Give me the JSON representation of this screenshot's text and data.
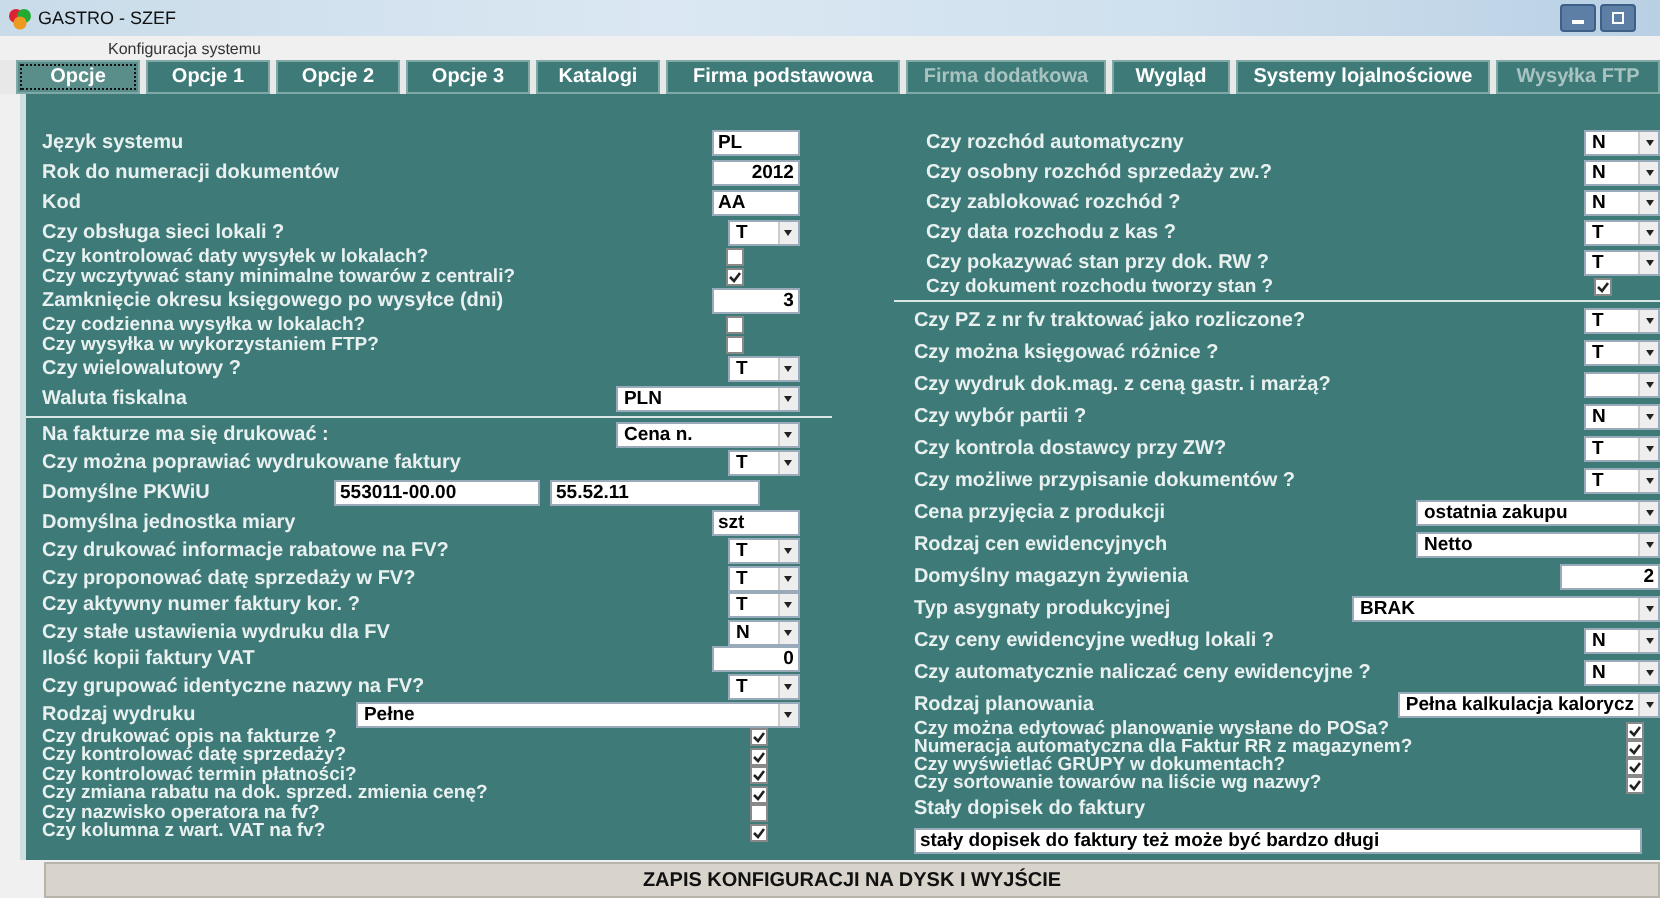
{
  "window": {
    "title": "GASTRO - SZEF",
    "subtitle": "Konfiguracja systemu"
  },
  "tabs": [
    {
      "label": "Opcje",
      "selected": true,
      "disabled": false
    },
    {
      "label": "Opcje 1",
      "selected": false,
      "disabled": false
    },
    {
      "label": "Opcje 2",
      "selected": false,
      "disabled": false
    },
    {
      "label": "Opcje 3",
      "selected": false,
      "disabled": false
    },
    {
      "label": "Katalogi",
      "selected": false,
      "disabled": false
    },
    {
      "label": "Firma podstawowa",
      "selected": false,
      "disabled": false
    },
    {
      "label": "Firma dodatkowa",
      "selected": false,
      "disabled": true
    },
    {
      "label": "Wygląd",
      "selected": false,
      "disabled": false
    },
    {
      "label": "Systemy lojalnościowe",
      "selected": false,
      "disabled": false
    },
    {
      "label": "Wysyłka FTP",
      "selected": false,
      "disabled": true
    }
  ],
  "left_sections": [
    {
      "rows": [
        {
          "kind": "input",
          "label": "Język systemu",
          "value": "PL"
        },
        {
          "kind": "number",
          "label": "Rok do numeracji dokumentów",
          "value": "2012"
        },
        {
          "kind": "input",
          "label": "Kod",
          "value": "AA"
        },
        {
          "kind": "dropdown",
          "label": "Czy obsługa sieci lokali ?",
          "value": "T"
        },
        {
          "kind": "check",
          "label": "Czy kontrolować daty wysyłek w lokalach?",
          "checked": false
        },
        {
          "kind": "check",
          "label": "Czy wczytywać stany minimalne towarów z centrali?",
          "checked": true
        },
        {
          "kind": "number",
          "label": "Zamknięcie okresu księgowego po wysyłce (dni)",
          "value": "3"
        },
        {
          "kind": "check",
          "label": "Czy codzienna wysyłka w lokalach?",
          "checked": false
        },
        {
          "kind": "check",
          "label": "Czy wysyłka w wykorzystaniem FTP?",
          "checked": false
        },
        {
          "kind": "dropdown",
          "label": "Czy wielowalutowy ?",
          "value": "T"
        },
        {
          "kind": "combo",
          "label": "Waluta fiskalna",
          "value": "PLN"
        }
      ]
    },
    {
      "rows": [
        {
          "kind": "combo",
          "label": "Na fakturze ma się drukować :",
          "value": "Cena n."
        },
        {
          "kind": "dropdown",
          "label": "Czy można poprawiać wydrukowane faktury",
          "value": "T"
        },
        {
          "kind": "pair",
          "label": "Domyślne PKWiU",
          "values": [
            "553011-00.00",
            "55.52.11"
          ]
        },
        {
          "kind": "input",
          "label": "Domyślna jednostka miary",
          "value": "szt"
        },
        {
          "kind": "dropdown",
          "label": "Czy drukować informacje rabatowe na FV?",
          "value": "T"
        },
        {
          "kind": "dropdown",
          "label": "Czy proponować datę sprzedaży w FV?",
          "value": "T"
        },
        {
          "kind": "dropdown",
          "label": "Czy aktywny numer faktury kor. ?",
          "value": "T"
        },
        {
          "kind": "dropdown",
          "label": "Czy stałe ustawienia wydruku dla FV",
          "value": "N"
        },
        {
          "kind": "number",
          "label": "Ilość kopii faktury VAT",
          "value": "0"
        },
        {
          "kind": "dropdown",
          "label": "Czy grupować identyczne nazwy na FV?",
          "value": "T"
        },
        {
          "kind": "long-combo",
          "label": "Rodzaj wydruku",
          "value": "Pełne"
        },
        {
          "kind": "check",
          "label": "Czy drukować opis na fakturze ?",
          "checked": true
        },
        {
          "kind": "check",
          "label": "Czy kontrolować datę sprzedaży?",
          "checked": true
        },
        {
          "kind": "check",
          "label": "Czy kontrolować termin płatności?",
          "checked": true
        },
        {
          "kind": "check",
          "label": "Czy zmiana rabatu na dok. sprzed. zmienia cenę?",
          "checked": true
        },
        {
          "kind": "check",
          "label": "Czy nazwisko operatora na fv?",
          "checked": false
        },
        {
          "kind": "check",
          "label": "Czy kolumna z wart. VAT na fv?",
          "checked": true
        }
      ]
    }
  ],
  "right_sections": [
    {
      "rows": [
        {
          "kind": "dropdown",
          "label": "Czy rozchód automatyczny",
          "value": "N"
        },
        {
          "kind": "dropdown",
          "label": "Czy osobny rozchód sprzedaży zw.?",
          "value": "N"
        },
        {
          "kind": "dropdown",
          "label": "Czy zablokować rozchód ?",
          "value": "N"
        },
        {
          "kind": "dropdown",
          "label": "Czy data rozchodu z kas ?",
          "value": "T"
        },
        {
          "kind": "dropdown",
          "label": "Czy pokazywać stan przy dok. RW ?",
          "value": "T"
        },
        {
          "kind": "check",
          "label": "Czy dokument rozchodu tworzy stan ?",
          "checked": true
        }
      ]
    },
    {
      "rows": [
        {
          "kind": "dropdown",
          "label": "Czy PZ z nr fv traktować jako rozliczone?",
          "value": "T"
        },
        {
          "kind": "dropdown",
          "label": "Czy można księgować różnice ?",
          "value": "T"
        },
        {
          "kind": "dropdown",
          "label": "Czy wydruk dok.mag. z ceną gastr. i marżą?"
        },
        {
          "kind": "dropdown",
          "label": "Czy wybór partii ?",
          "value": "N"
        },
        {
          "kind": "dropdown",
          "label": "Czy kontrola dostawcy przy ZW?",
          "value": "T"
        },
        {
          "kind": "dropdown",
          "label": "Czy możliwe przypisanie dokumentów ?",
          "value": "T"
        },
        {
          "kind": "combo",
          "label": "Cena przyjęcia z produkcji",
          "value": "ostatnia zakupu"
        },
        {
          "kind": "combo",
          "label": "Rodzaj cen ewidencyjnych",
          "value": "Netto"
        },
        {
          "kind": "number",
          "label": "Domyślny magazyn żywienia",
          "value": "2"
        },
        {
          "kind": "long-combo",
          "label": "Typ asygnaty produkcyjnej",
          "value": "BRAK"
        },
        {
          "kind": "dropdown",
          "label": "Czy ceny ewidencyjne według lokali ?",
          "value": "N"
        },
        {
          "kind": "dropdown",
          "label": "Czy automatycznie naliczać ceny ewidencyjne ?",
          "value": "N"
        },
        {
          "kind": "combo",
          "label": "Rodzaj planowania",
          "value": "Pełna kalkulacja kalorycz"
        },
        {
          "kind": "check",
          "label": "Czy można edytować planowanie wysłane do POSa?",
          "checked": true
        },
        {
          "kind": "check",
          "label": "Numeracja automatyczna dla Faktur RR z magazynem?",
          "checked": true
        },
        {
          "kind": "check",
          "label": "Czy wyświetlać GRUPY w dokumentach?",
          "checked": true
        },
        {
          "kind": "check",
          "label": "Czy sortowanie towarów na liście wg nazwy?",
          "checked": true
        },
        {
          "kind": "note",
          "label": "Stały dopisek do faktury"
        },
        {
          "kind": "long-input",
          "value": "stały dopisek do faktury też może być bardzo długi"
        }
      ]
    }
  ],
  "save_button": "ZAPIS KONFIGURACJI NA DYSK I WYJŚCIE"
}
